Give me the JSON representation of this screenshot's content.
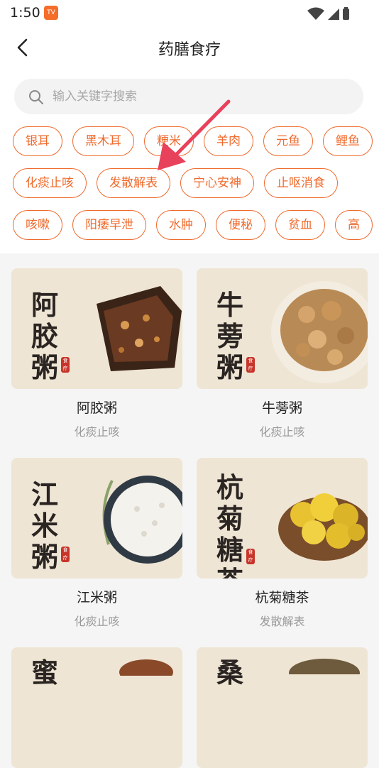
{
  "status": {
    "time": "1:50",
    "app_badge": "TV"
  },
  "header": {
    "title": "药膳食疗"
  },
  "search": {
    "placeholder": "输入关键字搜索"
  },
  "tags": {
    "row1": [
      "银耳",
      "黑木耳",
      "粳米",
      "羊肉",
      "元鱼",
      "鲤鱼"
    ],
    "row2": [
      "化痰止咳",
      "发散解表",
      "宁心安神",
      "止呕消食"
    ],
    "row3": [
      "咳嗽",
      "阳痿早泄",
      "水肿",
      "便秘",
      "贫血",
      "高"
    ]
  },
  "cards": [
    {
      "name": "阿胶粥",
      "category": "化痰止咳",
      "thumb_title": "阿胶粥",
      "seal": "食疗"
    },
    {
      "name": "牛蒡粥",
      "category": "化痰止咳",
      "thumb_title": "牛蒡粥",
      "seal": "食疗"
    },
    {
      "name": "江米粥",
      "category": "化痰止咳",
      "thumb_title": "江米粥",
      "seal": "食疗"
    },
    {
      "name": "杭菊糖茶",
      "category": "发散解表",
      "thumb_title": "杭菊糖茶",
      "seal": "食疗"
    },
    {
      "name": "",
      "category": "",
      "thumb_title": "蜜",
      "seal": ""
    },
    {
      "name": "",
      "category": "",
      "thumb_title": "桑",
      "seal": ""
    }
  ],
  "colors": {
    "accent": "#ef6a2c",
    "annotation_arrow": "#e8415b"
  }
}
